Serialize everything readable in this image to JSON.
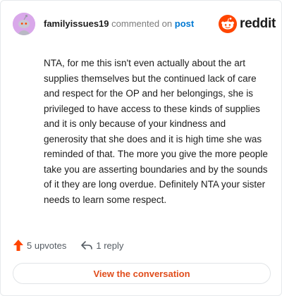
{
  "comment": {
    "author": "familyissues19",
    "action_text": "commented on",
    "target_link": "post",
    "body": "NTA, for me this isn't even actually about the art supplies themselves but the continued lack of care and respect for the OP and her belongings, she is privileged to have access to these kinds of supplies and it is only because of your kindness and generosity that she does and it is high time she was reminded of that. The more you give the more people take you are asserting boundaries and by the sounds of it they are long overdue. Definitely NTA your sister needs to learn some respect.",
    "avatar_icon": "snoo-avatar-icon",
    "avatar_bg": "#d9a8ea"
  },
  "brand": {
    "wordmark": "reddit",
    "logo_icon": "reddit-logo-icon",
    "color": "#ff4500"
  },
  "footer": {
    "upvotes_label": "5 upvotes",
    "upvote_icon": "upvote-arrow-icon",
    "upvote_color": "#ff4500",
    "reply_label": "1 reply",
    "reply_icon": "reply-arrow-icon"
  },
  "cta": {
    "label": "View the conversation",
    "color": "#e04c1b"
  }
}
